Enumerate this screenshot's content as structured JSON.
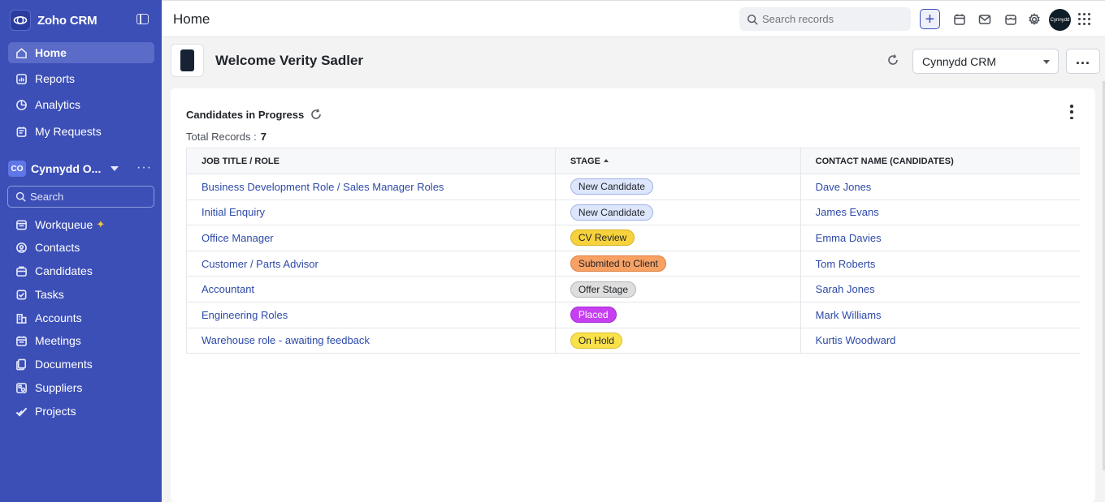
{
  "app": {
    "brand_name": "Zoho CRM",
    "page_title": "Home",
    "welcome": "Welcome Verity Sadler",
    "accent": "#3c4fb7"
  },
  "sidebar": {
    "top_items": [
      {
        "label": "Home",
        "icon": "home-icon",
        "active": true
      },
      {
        "label": "Reports",
        "icon": "reports-icon"
      },
      {
        "label": "Analytics",
        "icon": "analytics-icon"
      },
      {
        "label": "My Requests",
        "icon": "requests-icon"
      }
    ],
    "org": {
      "badge": "CO",
      "name": "Cynnydd O..."
    },
    "search_placeholder": "Search",
    "module_items": [
      {
        "label": "Workqueue",
        "icon": "workqueue-icon"
      },
      {
        "label": "Contacts",
        "icon": "contacts-icon"
      },
      {
        "label": "Candidates",
        "icon": "candidates-icon"
      },
      {
        "label": "Tasks",
        "icon": "tasks-icon"
      },
      {
        "label": "Accounts",
        "icon": "accounts-icon"
      },
      {
        "label": "Meetings",
        "icon": "meetings-icon"
      },
      {
        "label": "Documents",
        "icon": "documents-icon"
      },
      {
        "label": "Suppliers",
        "icon": "suppliers-icon"
      },
      {
        "label": "Projects",
        "icon": "projects-icon"
      }
    ]
  },
  "topbar": {
    "search_placeholder": "Search records",
    "avatar_text": "Cynnydd"
  },
  "header": {
    "crm_select_value": "Cynnydd CRM"
  },
  "card": {
    "title": "Candidates in Progress",
    "total_label": "Total Records :",
    "total_value": "7",
    "columns": [
      "JOB TITLE / ROLE",
      "STAGE",
      "CONTACT NAME (CANDIDATES)"
    ],
    "rows": [
      {
        "job": "Business Development Role / Sales Manager Roles",
        "stage": "New Candidate",
        "stage_bg": "#dde6fb",
        "stage_border": "#9fb3e6",
        "contact": "Dave Jones"
      },
      {
        "job": "Initial Enquiry",
        "stage": "New Candidate",
        "stage_bg": "#dde6fb",
        "stage_border": "#9fb3e6",
        "contact": "James Evans"
      },
      {
        "job": "Office Manager",
        "stage": "CV Review",
        "stage_bg": "#f7d23c",
        "stage_border": "#d8b21e",
        "contact": "Emma Davies"
      },
      {
        "job": "Customer / Parts Advisor",
        "stage": "Submited to Client",
        "stage_bg": "#f7a165",
        "stage_border": "#e07f3d",
        "contact": "Tom Roberts"
      },
      {
        "job": "Accountant",
        "stage": "Offer Stage",
        "stage_bg": "#dedede",
        "stage_border": "#b6b6b6",
        "contact": "Sarah Jones"
      },
      {
        "job": "Engineering Roles",
        "stage": "Placed",
        "stage_bg": "#c63ff0",
        "stage_border": "#a52bd0",
        "stage_color": "#ffffff",
        "contact": "Mark Williams"
      },
      {
        "job": "Warehouse role - awaiting feedback",
        "stage": "On Hold",
        "stage_bg": "#f8e14a",
        "stage_border": "#dcc22a",
        "contact": "Kurtis Woodward"
      }
    ]
  }
}
